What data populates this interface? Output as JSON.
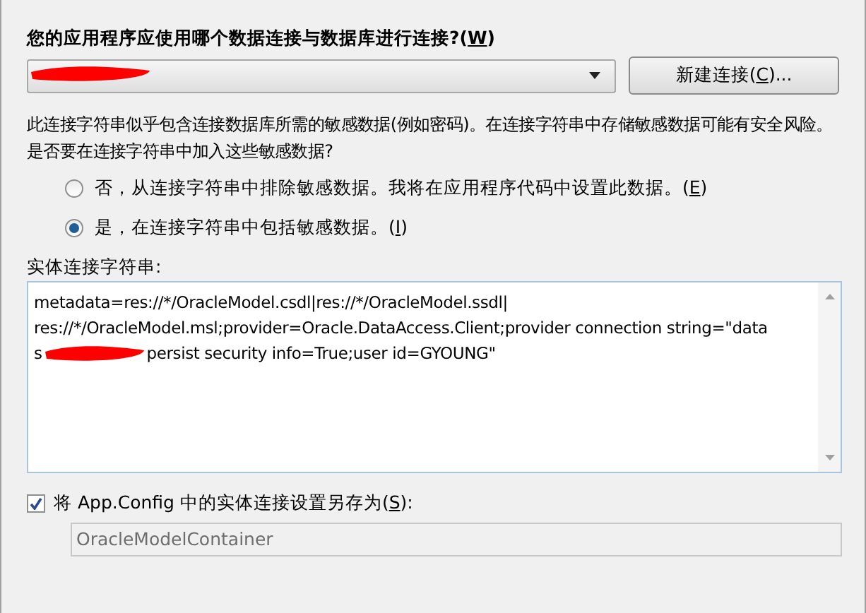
{
  "connection_prompt": {
    "before": "您的应用程序应使用哪个数据连接与数据库进行连接?(",
    "key": "W",
    "after": ")"
  },
  "connection_dropdown": {
    "redacted": true
  },
  "new_connection_button": {
    "before": "新建连接(",
    "key": "C",
    "after": ")..."
  },
  "sensitive_notice": "此连接字符串似乎包含连接数据库所需的敏感数据(例如密码)。在连接字符串中存储敏感数据可能有安全风险。是否要在连接字符串中加入这些敏感数据?",
  "options": [
    {
      "before": "否，从连接字符串中排除敏感数据。我将在应用程序代码中设置此数据。(",
      "key": "E",
      "after": ")",
      "selected": false
    },
    {
      "before": "是，在连接字符串中包括敏感数据。(",
      "key": "I",
      "after": ")",
      "selected": true
    }
  ],
  "entity_string_label": "实体连接字符串:",
  "entity_string_lines": [
    {
      "segments": [
        {
          "text": "metadata=res://*/OracleModel.csdl|res://*/OracleModel.ssdl|"
        }
      ]
    },
    {
      "segments": [
        {
          "text": "res://*/OracleModel.msl;provider=Oracle.DataAccess.Client;provider connection string=\"data"
        }
      ]
    },
    {
      "segments": [
        {
          "text": "s"
        },
        {
          "kind": "redaction"
        },
        {
          "text": "persist security info=True;user id=GYOUNG\""
        }
      ]
    }
  ],
  "save_setting": {
    "checked": true,
    "before": "将 App.Config 中的实体连接设置另存为(",
    "key": "S",
    "after": "):"
  },
  "container_name_field": {
    "value": "OracleModelContainer",
    "disabled": true
  }
}
